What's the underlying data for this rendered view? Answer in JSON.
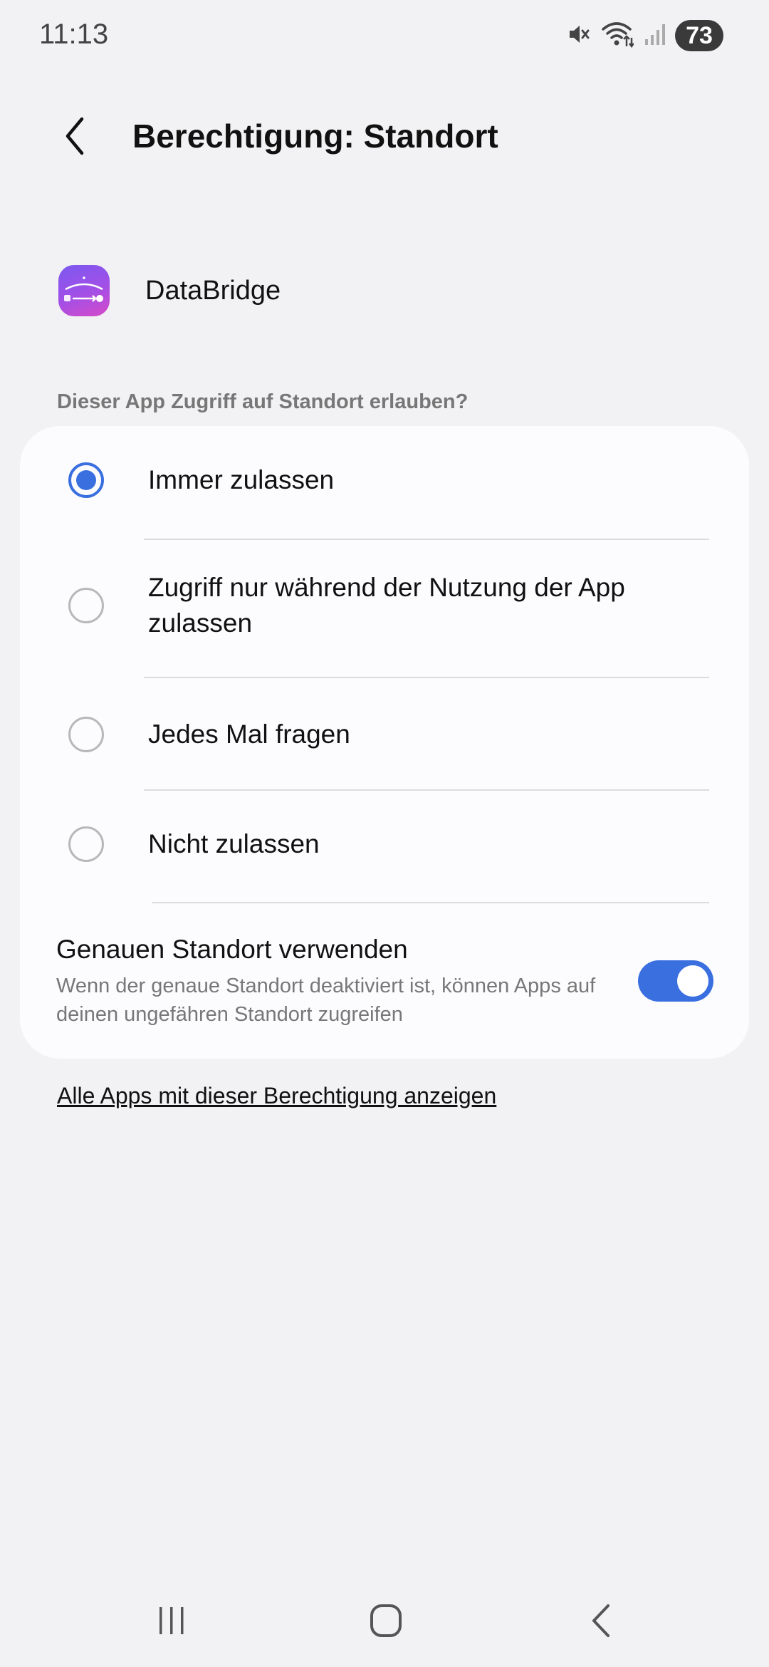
{
  "status_bar": {
    "time": "11:13",
    "battery": "73",
    "icons": [
      "mute-icon",
      "wifi-icon",
      "signal-icon",
      "battery-icon"
    ]
  },
  "header": {
    "title": "Berechtigung: Standort",
    "back_icon": "chevron-left-icon"
  },
  "app": {
    "name": "DataBridge",
    "icon": "databridge-app-icon"
  },
  "question": "Dieser App Zugriff auf Standort erlauben?",
  "options": [
    {
      "label": "Immer zulassen",
      "selected": true
    },
    {
      "label": "Zugriff nur während der Nutzung der App zulassen",
      "selected": false
    },
    {
      "label": "Jedes Mal fragen",
      "selected": false
    },
    {
      "label": "Nicht zulassen",
      "selected": false
    }
  ],
  "precise_location": {
    "title": "Genauen Standort verwenden",
    "description": "Wenn der genaue Standort deaktiviert ist, können Apps auf deinen ungefähren Standort zugreifen",
    "enabled": true
  },
  "all_apps_link": "Alle Apps mit dieser Berechtigung anzeigen",
  "nav_bar": {
    "icons": [
      "recents-icon",
      "home-icon",
      "back-icon"
    ]
  },
  "colors": {
    "accent": "#3a6fe0",
    "background": "#f2f2f4",
    "card": "#fcfcfe",
    "secondary_text": "#777777"
  }
}
